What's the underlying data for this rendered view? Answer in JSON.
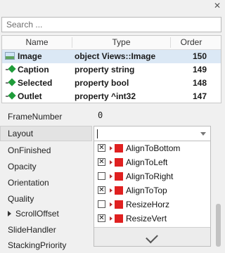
{
  "search": {
    "placeholder": "Search ..."
  },
  "table": {
    "headers": {
      "name": "Name",
      "type": "Type",
      "order": "Order"
    },
    "rows": [
      {
        "icon": "image-icon",
        "name": "Image",
        "type": "object Views::Image",
        "order": "150",
        "selected": true
      },
      {
        "icon": "green-diamond-icon",
        "name": "Caption",
        "type": "property string",
        "order": "149"
      },
      {
        "icon": "green-diamond-icon",
        "name": "Selected",
        "type": "property bool",
        "order": "148"
      },
      {
        "icon": "green-diamond-icon",
        "name": "Outlet",
        "type": "property ^int32",
        "order": "147"
      }
    ]
  },
  "properties": {
    "items": [
      {
        "label": "FrameNumber"
      },
      {
        "label": "Layout",
        "selected": true
      },
      {
        "label": "OnFinished"
      },
      {
        "label": "Opacity"
      },
      {
        "label": "Orientation"
      },
      {
        "label": "Quality"
      },
      {
        "label": "ScrollOffset",
        "expandable": true
      },
      {
        "label": "SlideHandler"
      },
      {
        "label": "StackingPriority"
      }
    ],
    "frame_number_value": "0"
  },
  "layout_dropdown": {
    "current_value": "",
    "options": [
      {
        "label": "AlignToBottom",
        "checked": true
      },
      {
        "label": "AlignToLeft",
        "checked": true
      },
      {
        "label": "AlignToRight",
        "checked": false
      },
      {
        "label": "AlignToTop",
        "checked": true
      },
      {
        "label": "ResizeHorz",
        "checked": false
      },
      {
        "label": "ResizeVert",
        "checked": true
      }
    ],
    "check_glyph": "✕",
    "ok_icon": "checkmark-icon"
  },
  "colors": {
    "selection": "#dbe8f5",
    "flag_red": "#e02020",
    "diamond_green": "#1f9c3a"
  }
}
